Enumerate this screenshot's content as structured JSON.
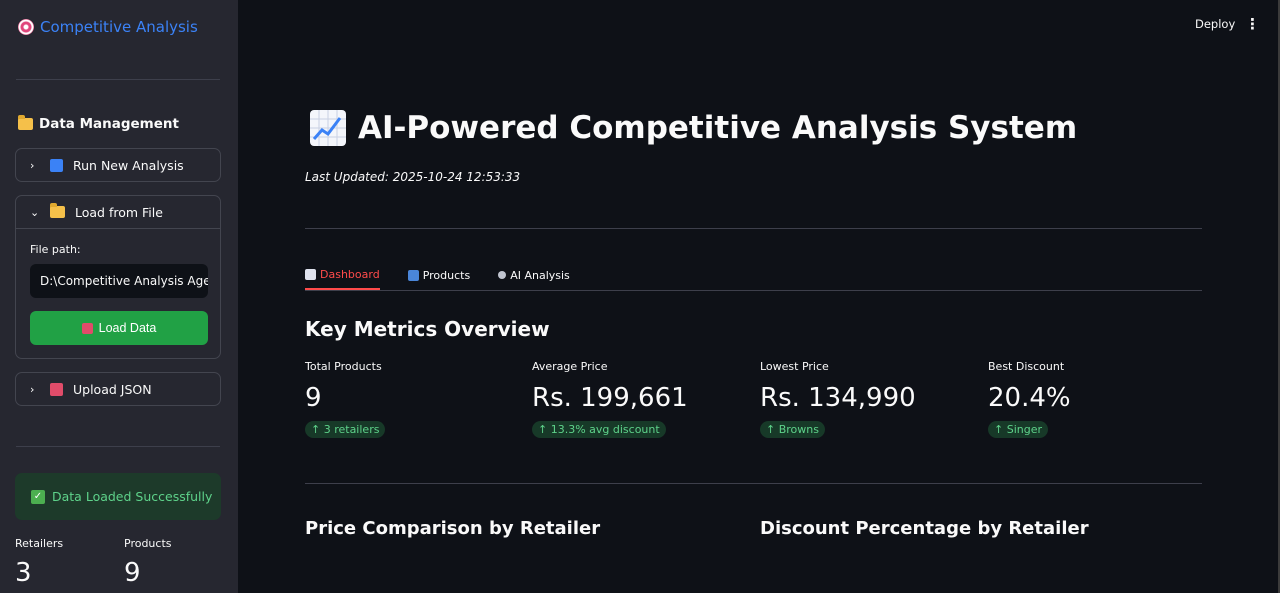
{
  "sidebar": {
    "title": "Competitive Analysis",
    "section_title": "Data Management",
    "run_new": "Run New Analysis",
    "load_file": "Load from File",
    "file_path_label": "File path:",
    "file_path_value": "D:\\Competitive Analysis Agent",
    "load_button": "Load Data",
    "upload_json": "Upload JSON",
    "success_msg": "Data Loaded Successfully",
    "metrics": [
      {
        "label": "Retailers",
        "value": "3"
      },
      {
        "label": "Products",
        "value": "9"
      }
    ]
  },
  "topbar": {
    "deploy": "Deploy",
    "menu": "⋮"
  },
  "main": {
    "title": "AI-Powered Competitive Analysis System",
    "updated": "Last Updated: 2025-10-24 12:53:33",
    "tabs": [
      {
        "label": "Dashboard",
        "active": true
      },
      {
        "label": "Products",
        "active": false
      },
      {
        "label": "AI Analysis",
        "active": false
      }
    ],
    "metrics_heading": "Key Metrics Overview",
    "metrics": [
      {
        "label": "Total Products",
        "value": "9",
        "delta": "↑ 3 retailers"
      },
      {
        "label": "Average Price",
        "value": "Rs. 199,661",
        "delta": "↑ 13.3% avg discount"
      },
      {
        "label": "Lowest Price",
        "value": "Rs. 134,990",
        "delta": "↑ Browns"
      },
      {
        "label": "Best Discount",
        "value": "20.4%",
        "delta": "↑ Singer"
      }
    ],
    "chart_heading_left": "Price Comparison by Retailer",
    "chart_heading_right": "Discount Percentage by Retailer"
  }
}
